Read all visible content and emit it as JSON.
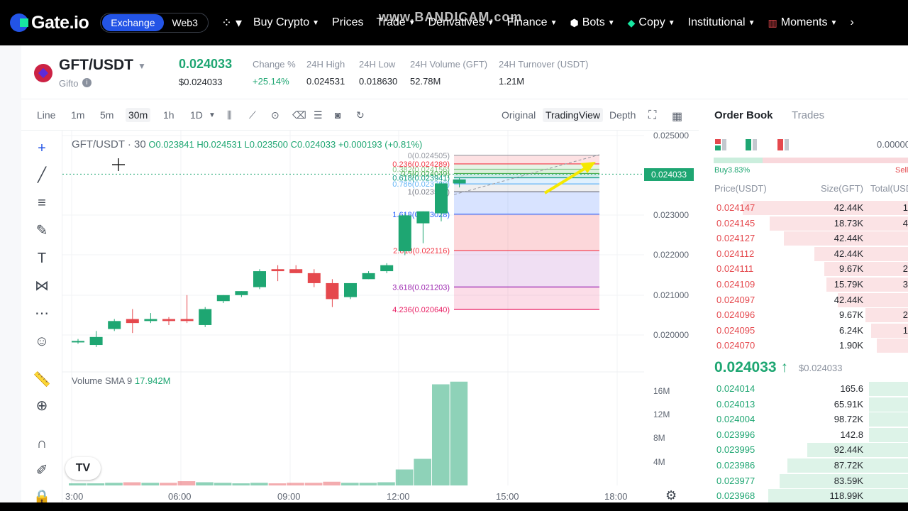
{
  "nav": {
    "logo": "Gate.io",
    "modes": [
      "Exchange",
      "Web3"
    ],
    "items": [
      {
        "label": "Buy Crypto"
      },
      {
        "label": "Prices"
      },
      {
        "label": "Trade"
      },
      {
        "label": "Derivatives"
      },
      {
        "label": "Finance"
      },
      {
        "label": "Bots"
      },
      {
        "label": "Copy"
      },
      {
        "label": "Institutional"
      },
      {
        "label": "Moments"
      }
    ],
    "watermark": "www.BANDICAM.com"
  },
  "ticker": {
    "pair": "GFT/USDT",
    "coin_name": "Gifto",
    "last_price": "0.024033",
    "last_price_usd": "$0.024033",
    "stats": [
      {
        "label": "Change %",
        "value": "+25.14%"
      },
      {
        "label": "24H High",
        "value": "0.024531"
      },
      {
        "label": "24H Low",
        "value": "0.018630"
      },
      {
        "label": "24H Volume (GFT)",
        "value": "52.78M"
      },
      {
        "label": "24H Turnover (USDT)",
        "value": "1.21M"
      }
    ]
  },
  "toolbar": {
    "intervals": [
      "Line",
      "1m",
      "5m",
      "30m",
      "1h",
      "1D"
    ],
    "views": [
      "Original",
      "TradingView",
      "Depth"
    ]
  },
  "chart": {
    "legend_title": "GFT/USDT · 30",
    "ohlc": "O0.023841 H0.024531 L0.023500 C0.024033 +0.000193 (+0.81%)",
    "volume_label": "Volume SMA 9",
    "volume_value": "17.942M",
    "current_price_tag": "0.024033",
    "y_ticks": [
      "0.025000",
      "0.023000",
      "0.022000",
      "0.021000",
      "0.020000"
    ],
    "vol_ticks": [
      "16M",
      "12M",
      "8M",
      "4M"
    ],
    "x_ticks": [
      "3:00",
      "06:00",
      "09:00",
      "12:00",
      "15:00",
      "18:00"
    ],
    "fib_labels": [
      "0(0.024505)",
      "0.236(0.024289)",
      "0.382(0.024156)",
      "0.5(0.024049)",
      "0.618(0.023941)",
      "0.786(0.023788)",
      "1(0.023592)",
      "1.618(0.023028)",
      "2.618(0.022116)",
      "3.618(0.021203)",
      "4.236(0.020640)"
    ],
    "colors": {
      "up": "#1ea672",
      "down": "#e5484d"
    }
  },
  "chart_data": {
    "type": "candlestick",
    "x_unit": "30m bars",
    "ylim": [
      0.0197,
      0.0252
    ],
    "candles": [
      {
        "o": 0.01985,
        "h": 0.0199,
        "l": 0.01978,
        "c": 0.01985
      },
      {
        "o": 0.01975,
        "h": 0.0201,
        "l": 0.0197,
        "c": 0.01995
      },
      {
        "o": 0.02015,
        "h": 0.0204,
        "l": 0.0201,
        "c": 0.02035
      },
      {
        "o": 0.0204,
        "h": 0.02065,
        "l": 0.02005,
        "c": 0.0203
      },
      {
        "o": 0.02035,
        "h": 0.02055,
        "l": 0.0203,
        "c": 0.0204
      },
      {
        "o": 0.0204,
        "h": 0.02045,
        "l": 0.02025,
        "c": 0.02035
      },
      {
        "o": 0.0204,
        "h": 0.021,
        "l": 0.0203,
        "c": 0.02035
      },
      {
        "o": 0.02025,
        "h": 0.0207,
        "l": 0.0202,
        "c": 0.02065
      },
      {
        "o": 0.02085,
        "h": 0.021,
        "l": 0.0208,
        "c": 0.021
      },
      {
        "o": 0.021,
        "h": 0.0211,
        "l": 0.02095,
        "c": 0.0211
      },
      {
        "o": 0.0212,
        "h": 0.02165,
        "l": 0.02115,
        "c": 0.0216
      },
      {
        "o": 0.02165,
        "h": 0.02175,
        "l": 0.02135,
        "c": 0.0216
      },
      {
        "o": 0.02165,
        "h": 0.02175,
        "l": 0.02155,
        "c": 0.02155
      },
      {
        "o": 0.02155,
        "h": 0.02165,
        "l": 0.0212,
        "c": 0.0213
      },
      {
        "o": 0.0213,
        "h": 0.0214,
        "l": 0.0207,
        "c": 0.0209
      },
      {
        "o": 0.02095,
        "h": 0.0213,
        "l": 0.0209,
        "c": 0.0213
      },
      {
        "o": 0.0214,
        "h": 0.0216,
        "l": 0.0214,
        "c": 0.02155
      },
      {
        "o": 0.0216,
        "h": 0.0218,
        "l": 0.02155,
        "c": 0.02175
      },
      {
        "o": 0.0221,
        "h": 0.02305,
        "l": 0.022,
        "c": 0.023
      },
      {
        "o": 0.0228,
        "h": 0.0231,
        "l": 0.0223,
        "c": 0.0231
      },
      {
        "o": 0.02305,
        "h": 0.02385,
        "l": 0.02285,
        "c": 0.0238
      },
      {
        "o": 0.0238,
        "h": 0.02395,
        "l": 0.0237,
        "c": 0.0239
      }
    ],
    "volumes": [
      0.4,
      0.4,
      0.5,
      0.6,
      0.5,
      0.5,
      0.8,
      0.6,
      0.5,
      0.4,
      0.5,
      0.4,
      0.5,
      0.5,
      0.7,
      0.5,
      0.5,
      0.6,
      3.0,
      5.0,
      19.0,
      19.5
    ],
    "vol_ylim": [
      0,
      20
    ]
  },
  "orderbook": {
    "tabs": [
      "Order Book",
      "Trades"
    ],
    "decimals": "0.00000",
    "buy_ratio": "Buy3.83%",
    "sell_label": "Sell",
    "buy_share": 0.25,
    "headers": {
      "price": "Price(USDT)",
      "size": "Size(GFT)",
      "total": "Total(USDT)"
    },
    "asks": [
      {
        "price": "0.024147",
        "size": "42.44K",
        "total": "1",
        "depth": 0.85
      },
      {
        "price": "0.024145",
        "size": "18.73K",
        "total": "4",
        "depth": 0.71
      },
      {
        "price": "0.024127",
        "size": "42.44K",
        "total": "",
        "depth": 0.64
      },
      {
        "price": "0.024112",
        "size": "42.44K",
        "total": "",
        "depth": 0.48
      },
      {
        "price": "0.024111",
        "size": "9.67K",
        "total": "2",
        "depth": 0.43
      },
      {
        "price": "0.024109",
        "size": "15.79K",
        "total": "3",
        "depth": 0.42
      },
      {
        "price": "0.024097",
        "size": "42.44K",
        "total": "",
        "depth": 0.36
      },
      {
        "price": "0.024096",
        "size": "9.67K",
        "total": "2",
        "depth": 0.22
      },
      {
        "price": "0.024095",
        "size": "6.24K",
        "total": "1",
        "depth": 0.19
      },
      {
        "price": "0.024070",
        "size": "1.90K",
        "total": "",
        "depth": 0.16
      }
    ],
    "mid_price": "0.024033",
    "mid_usd": "$0.024033",
    "bids": [
      {
        "price": "0.024014",
        "size": "165.6",
        "total": "",
        "depth": 0.2
      },
      {
        "price": "0.024013",
        "size": "65.91K",
        "total": "",
        "depth": 0.2
      },
      {
        "price": "0.024004",
        "size": "98.72K",
        "total": "",
        "depth": 0.2
      },
      {
        "price": "0.023996",
        "size": "142.8",
        "total": "",
        "depth": 0.2
      },
      {
        "price": "0.023995",
        "size": "92.44K",
        "total": "",
        "depth": 0.52
      },
      {
        "price": "0.023986",
        "size": "87.72K",
        "total": "",
        "depth": 0.62
      },
      {
        "price": "0.023977",
        "size": "83.59K",
        "total": "",
        "depth": 0.66
      },
      {
        "price": "0.023968",
        "size": "118.99K",
        "total": "",
        "depth": 0.72
      }
    ]
  }
}
